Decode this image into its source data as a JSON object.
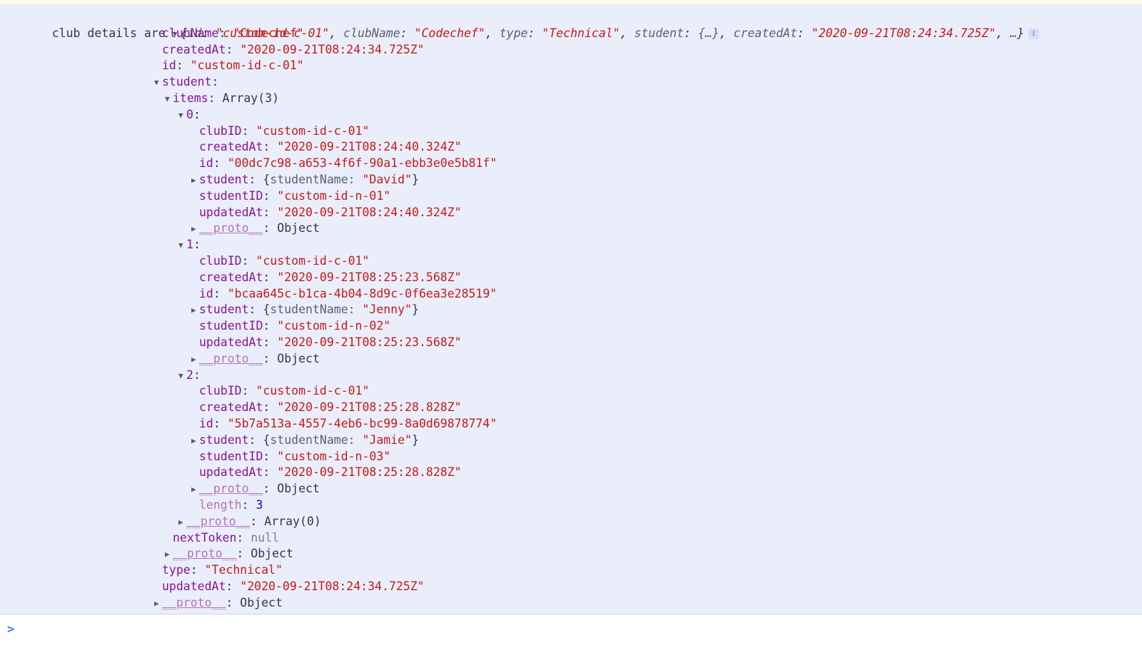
{
  "console": {
    "warning_strip_visible": true,
    "colors": {
      "log_background": "#eaeefb",
      "key": "#881391",
      "string": "#c41a16",
      "number": "#1c00cf",
      "builtin_key": "#b272b2",
      "prompt_caret": "#3b78e7",
      "info_badge_bg": "#d6deff"
    },
    "first_line": {
      "message": "club details are",
      "triangle": "open",
      "preview": {
        "open_brace": "{",
        "entries": [
          {
            "key": "id",
            "sep": ": ",
            "value": "\"custom-id-c-01\"",
            "trail": ", "
          },
          {
            "key": "clubName",
            "sep": ": ",
            "value": "\"Codechef\"",
            "trail": ", "
          },
          {
            "key": "type",
            "sep": ": ",
            "value": "\"Technical\"",
            "trail": ", "
          },
          {
            "key": "student",
            "sep": ": ",
            "value": "{…}",
            "trail": ", ",
            "value_kind": "sub"
          },
          {
            "key": "createdAt",
            "sep": ": ",
            "value": "\"2020-09-21T08:24:34.725Z\"",
            "trail": ", "
          }
        ],
        "ellipsis": "…",
        "close_brace": "}"
      },
      "info_icon": "info-icon",
      "info_icon_glyph": "i"
    },
    "rows": [
      {
        "indent": "i1",
        "tri": "spacer",
        "key": "clubName",
        "key_kind": "key",
        "value": "\"Codechef\"",
        "value_kind": "str"
      },
      {
        "indent": "i1",
        "tri": "spacer",
        "key": "createdAt",
        "key_kind": "key",
        "value": "\"2020-09-21T08:24:34.725Z\"",
        "value_kind": "str"
      },
      {
        "indent": "i1",
        "tri": "spacer",
        "key": "id",
        "key_kind": "key",
        "value": "\"custom-id-c-01\"",
        "value_kind": "str"
      },
      {
        "indent": "i1",
        "tri": "open",
        "key": "student",
        "key_kind": "key",
        "value": "",
        "value_kind": "plain"
      },
      {
        "indent": "i2",
        "tri": "open",
        "key": "items",
        "key_kind": "key",
        "value": "Array(3)",
        "value_kind": "plain"
      },
      {
        "indent": "i3",
        "tri": "open",
        "key": "0",
        "key_kind": "key",
        "value": "",
        "value_kind": "plain"
      },
      {
        "indent": "i4",
        "tri": "spacer",
        "key": "clubID",
        "key_kind": "key",
        "value": "\"custom-id-c-01\"",
        "value_kind": "str"
      },
      {
        "indent": "i4",
        "tri": "spacer",
        "key": "createdAt",
        "key_kind": "key",
        "value": "\"2020-09-21T08:24:40.324Z\"",
        "value_kind": "str"
      },
      {
        "indent": "i4",
        "tri": "spacer",
        "key": "id",
        "key_kind": "key",
        "value": "\"00dc7c98-a653-4f6f-90a1-ebb3e0e5b81f\"",
        "value_kind": "str"
      },
      {
        "indent": "i4",
        "tri": "closed",
        "key": "student",
        "key_kind": "key",
        "value": "{studentName: \"David\"}",
        "value_kind": "objpreview",
        "preview_key": "studentName",
        "preview_str": "\"David\""
      },
      {
        "indent": "i4",
        "tri": "spacer",
        "key": "studentID",
        "key_kind": "key",
        "value": "\"custom-id-n-01\"",
        "value_kind": "str"
      },
      {
        "indent": "i4",
        "tri": "spacer",
        "key": "updatedAt",
        "key_kind": "key",
        "value": "\"2020-09-21T08:24:40.324Z\"",
        "value_kind": "str"
      },
      {
        "indent": "i4",
        "tri": "closed",
        "key": "__proto__",
        "key_kind": "key-proto",
        "value": "Object",
        "value_kind": "plain"
      },
      {
        "indent": "i3",
        "tri": "open",
        "key": "1",
        "key_kind": "key",
        "value": "",
        "value_kind": "plain"
      },
      {
        "indent": "i4",
        "tri": "spacer",
        "key": "clubID",
        "key_kind": "key",
        "value": "\"custom-id-c-01\"",
        "value_kind": "str"
      },
      {
        "indent": "i4",
        "tri": "spacer",
        "key": "createdAt",
        "key_kind": "key",
        "value": "\"2020-09-21T08:25:23.568Z\"",
        "value_kind": "str"
      },
      {
        "indent": "i4",
        "tri": "spacer",
        "key": "id",
        "key_kind": "key",
        "value": "\"bcaa645c-b1ca-4b04-8d9c-0f6ea3e28519\"",
        "value_kind": "str"
      },
      {
        "indent": "i4",
        "tri": "closed",
        "key": "student",
        "key_kind": "key",
        "value": "{studentName: \"Jenny\"}",
        "value_kind": "objpreview",
        "preview_key": "studentName",
        "preview_str": "\"Jenny\""
      },
      {
        "indent": "i4",
        "tri": "spacer",
        "key": "studentID",
        "key_kind": "key",
        "value": "\"custom-id-n-02\"",
        "value_kind": "str"
      },
      {
        "indent": "i4",
        "tri": "spacer",
        "key": "updatedAt",
        "key_kind": "key",
        "value": "\"2020-09-21T08:25:23.568Z\"",
        "value_kind": "str"
      },
      {
        "indent": "i4",
        "tri": "closed",
        "key": "__proto__",
        "key_kind": "key-proto",
        "value": "Object",
        "value_kind": "plain"
      },
      {
        "indent": "i3",
        "tri": "open",
        "key": "2",
        "key_kind": "key",
        "value": "",
        "value_kind": "plain"
      },
      {
        "indent": "i4",
        "tri": "spacer",
        "key": "clubID",
        "key_kind": "key",
        "value": "\"custom-id-c-01\"",
        "value_kind": "str"
      },
      {
        "indent": "i4",
        "tri": "spacer",
        "key": "createdAt",
        "key_kind": "key",
        "value": "\"2020-09-21T08:25:28.828Z\"",
        "value_kind": "str"
      },
      {
        "indent": "i4",
        "tri": "spacer",
        "key": "id",
        "key_kind": "key",
        "value": "\"5b7a513a-4557-4eb6-bc99-8a0d69878774\"",
        "value_kind": "str"
      },
      {
        "indent": "i4",
        "tri": "closed",
        "key": "student",
        "key_kind": "key",
        "value": "{studentName: \"Jamie\"}",
        "value_kind": "objpreview",
        "preview_key": "studentName",
        "preview_str": "\"Jamie\""
      },
      {
        "indent": "i4",
        "tri": "spacer",
        "key": "studentID",
        "key_kind": "key",
        "value": "\"custom-id-n-03\"",
        "value_kind": "str"
      },
      {
        "indent": "i4",
        "tri": "spacer",
        "key": "updatedAt",
        "key_kind": "key",
        "value": "\"2020-09-21T08:25:28.828Z\"",
        "value_kind": "str"
      },
      {
        "indent": "i4",
        "tri": "closed",
        "key": "__proto__",
        "key_kind": "key-proto",
        "value": "Object",
        "value_kind": "plain"
      },
      {
        "indent": "i4",
        "tri": "spacer",
        "key": "length",
        "key_kind": "key-builtin",
        "value": "3",
        "value_kind": "num"
      },
      {
        "indent": "i3",
        "tri": "closed",
        "key": "__proto__",
        "key_kind": "key-proto",
        "value": "Array(0)",
        "value_kind": "plain"
      },
      {
        "indent": "i2",
        "tri": "spacer",
        "key": "nextToken",
        "key_kind": "key",
        "value": "null",
        "value_kind": "nul"
      },
      {
        "indent": "i2",
        "tri": "closed",
        "key": "__proto__",
        "key_kind": "key-proto",
        "value": "Object",
        "value_kind": "plain"
      },
      {
        "indent": "i1",
        "tri": "spacer",
        "key": "type",
        "key_kind": "key",
        "value": "\"Technical\"",
        "value_kind": "str"
      },
      {
        "indent": "i1",
        "tri": "spacer",
        "key": "updatedAt",
        "key_kind": "key",
        "value": "\"2020-09-21T08:24:34.725Z\"",
        "value_kind": "str"
      },
      {
        "indent": "i1",
        "tri": "closed",
        "key": "__proto__",
        "key_kind": "key-proto",
        "value": "Object",
        "value_kind": "plain"
      }
    ],
    "prompt": {
      "caret": ">",
      "value": "",
      "placeholder": ""
    }
  }
}
